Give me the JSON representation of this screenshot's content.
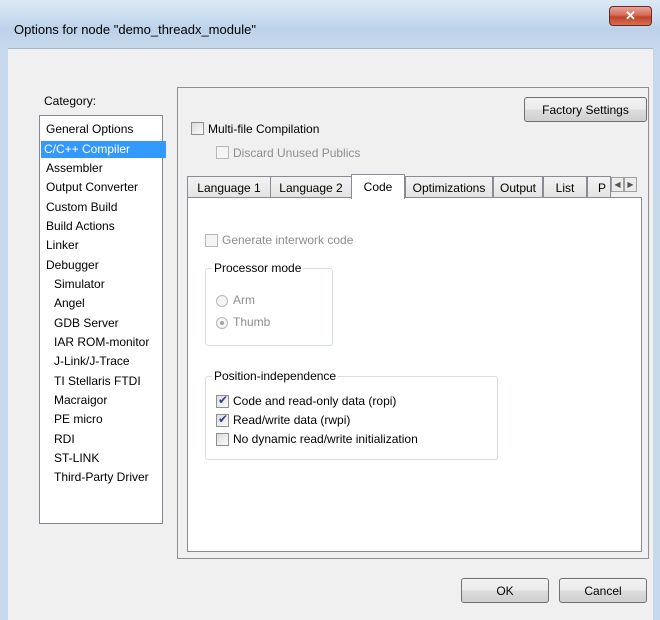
{
  "window": {
    "title": "Options for node \"demo_threadx_module\"",
    "close_glyph": "✕"
  },
  "category": {
    "label": "Category:",
    "items": [
      {
        "label": "General Options"
      },
      {
        "label": "C/C++ Compiler"
      },
      {
        "label": "Assembler"
      },
      {
        "label": "Output Converter"
      },
      {
        "label": "Custom Build"
      },
      {
        "label": "Build Actions"
      },
      {
        "label": "Linker"
      },
      {
        "label": "Debugger"
      },
      {
        "label": "Simulator"
      },
      {
        "label": "Angel"
      },
      {
        "label": "GDB Server"
      },
      {
        "label": "IAR ROM-monitor"
      },
      {
        "label": "J-Link/J-Trace"
      },
      {
        "label": "TI Stellaris FTDI"
      },
      {
        "label": "Macraigor"
      },
      {
        "label": "PE micro"
      },
      {
        "label": "RDI"
      },
      {
        "label": "ST-LINK"
      },
      {
        "label": "Third-Party Driver"
      }
    ],
    "selected": "C/C++ Compiler"
  },
  "panel": {
    "factory_settings": "Factory Settings",
    "multifile": {
      "label": "Multi-file Compilation",
      "checked": false
    },
    "discard_unused": {
      "label": "Discard Unused Publics",
      "checked": false,
      "enabled": false
    }
  },
  "tabs": [
    {
      "label": "Language 1"
    },
    {
      "label": "Language 2"
    },
    {
      "label": "Code",
      "active": true
    },
    {
      "label": "Optimizations"
    },
    {
      "label": "Output"
    },
    {
      "label": "List"
    },
    {
      "label": "P"
    }
  ],
  "code_tab": {
    "interwork": {
      "label": "Generate interwork code",
      "checked": false,
      "enabled": false
    },
    "processor_mode": {
      "title": "Processor mode",
      "options": [
        {
          "label": "Arm",
          "selected": false
        },
        {
          "label": "Thumb",
          "selected": true
        }
      ]
    },
    "position_independence": {
      "title": "Position-independence",
      "options": [
        {
          "label": "Code and read-only data (ropi)",
          "checked": true
        },
        {
          "label": "Read/write data (rwpi)",
          "checked": true
        },
        {
          "label": "No dynamic read/write initialization",
          "checked": false
        }
      ]
    }
  },
  "footer": {
    "ok": "OK",
    "cancel": "Cancel"
  },
  "colors": {
    "selection": "#3399ff",
    "close_button": "#c0432c"
  }
}
